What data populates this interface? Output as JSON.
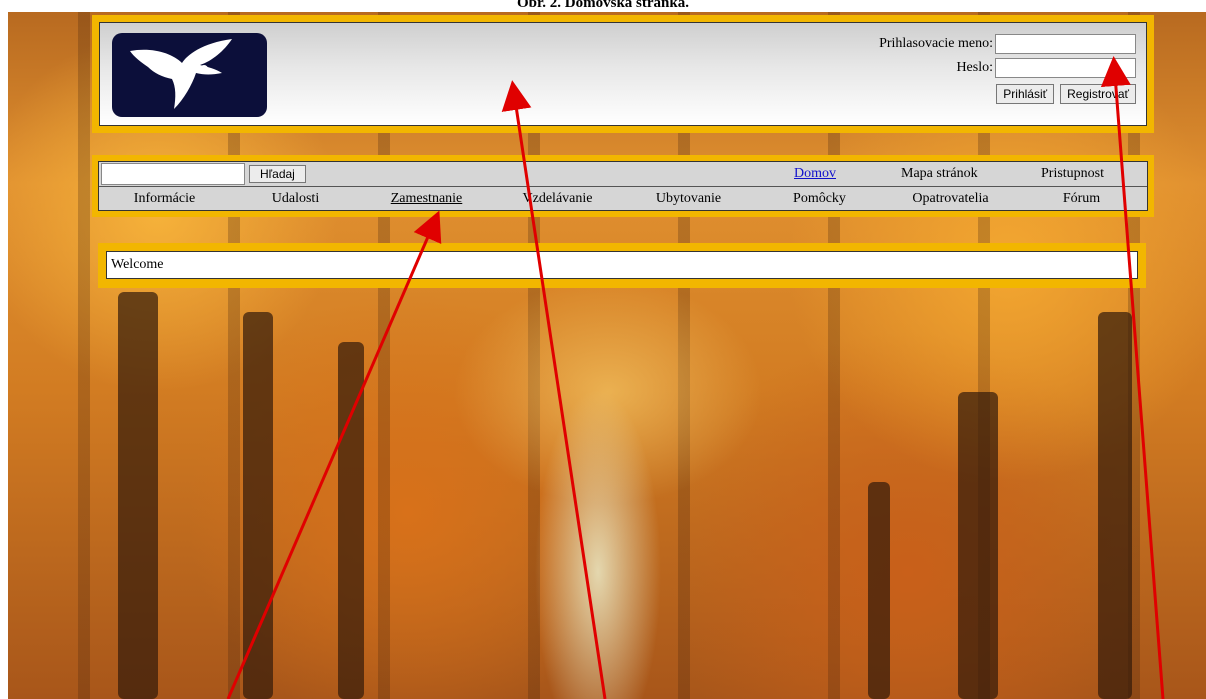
{
  "caption": "Obr. 2. Domovská stránka.",
  "header": {
    "login_label": "Prihlasovacie meno:",
    "login_value": "",
    "password_label": "Heslo:",
    "password_value": "",
    "login_button": "Prihlásiť",
    "register_button": "Registrovať"
  },
  "nav": {
    "search_value": "",
    "search_button": "Hľadaj",
    "top_links": [
      "Domov",
      "Mapa stránok",
      "Pristupnost"
    ],
    "items": [
      "Informácie",
      "Udalosti",
      "Zamestnanie",
      "Vzdelávanie",
      "Ubytovanie",
      "Pomôcky",
      "Opatrovatelia",
      "Fórum"
    ]
  },
  "content": {
    "text": "Welcome"
  },
  "colors": {
    "panel_border": "#f2b600",
    "logo_bg": "#0c0f3a",
    "link": "#1010cc",
    "arrow": "#e00000"
  }
}
